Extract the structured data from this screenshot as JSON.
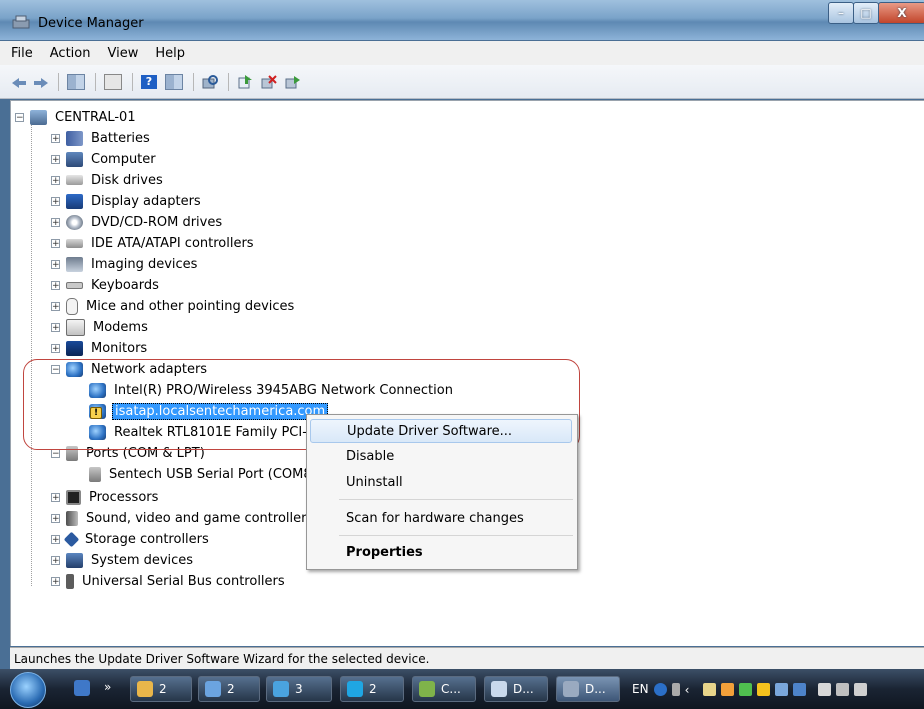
{
  "window": {
    "title": "Device Manager",
    "min": "–",
    "max": "□",
    "close": "X"
  },
  "menu": [
    "File",
    "Action",
    "View",
    "Help"
  ],
  "tree": {
    "root": "CENTRAL-01",
    "categories": [
      {
        "label": "Batteries",
        "icon": "battery-icon"
      },
      {
        "label": "Computer",
        "icon": "computer-icon"
      },
      {
        "label": "Disk drives",
        "icon": "disk-drive-icon"
      },
      {
        "label": "Display adapters",
        "icon": "display-adapter-icon"
      },
      {
        "label": "DVD/CD-ROM drives",
        "icon": "dvd-drive-icon"
      },
      {
        "label": "IDE ATA/ATAPI controllers",
        "icon": "ide-controller-icon"
      },
      {
        "label": "Imaging devices",
        "icon": "imaging-device-icon"
      },
      {
        "label": "Keyboards",
        "icon": "keyboard-icon"
      },
      {
        "label": "Mice and other pointing devices",
        "icon": "mouse-icon"
      },
      {
        "label": "Modems",
        "icon": "modem-icon"
      },
      {
        "label": "Monitors",
        "icon": "monitor-icon"
      },
      {
        "label": "Network adapters",
        "icon": "network-adapter-icon"
      },
      {
        "label": "Ports (COM & LPT)",
        "icon": "port-icon"
      },
      {
        "label": "Processors",
        "icon": "processor-icon"
      },
      {
        "label": "Sound, video and game controllers",
        "icon": "sound-icon"
      },
      {
        "label": "Storage controllers",
        "icon": "storage-controller-icon"
      },
      {
        "label": "System devices",
        "icon": "system-device-icon"
      },
      {
        "label": "Universal Serial Bus controllers",
        "icon": "usb-icon"
      }
    ],
    "network_adapters": [
      "Intel(R) PRO/Wireless 3945ABG Network Connection",
      "isatap.localsentechamerica.com",
      "Realtek RTL8101E Family PCI-E"
    ],
    "ports": [
      "Sentech USB Serial Port (COM8"
    ]
  },
  "context_menu": {
    "update": "Update Driver Software...",
    "disable": "Disable",
    "uninstall": "Uninstall",
    "scan": "Scan for hardware changes",
    "properties": "Properties"
  },
  "status": "Launches the Update Driver Software Wizard for the selected device.",
  "taskbar": {
    "buttons": [
      "2",
      "2",
      "3",
      "2",
      "C...",
      "D...",
      "D..."
    ],
    "lang": "EN"
  }
}
